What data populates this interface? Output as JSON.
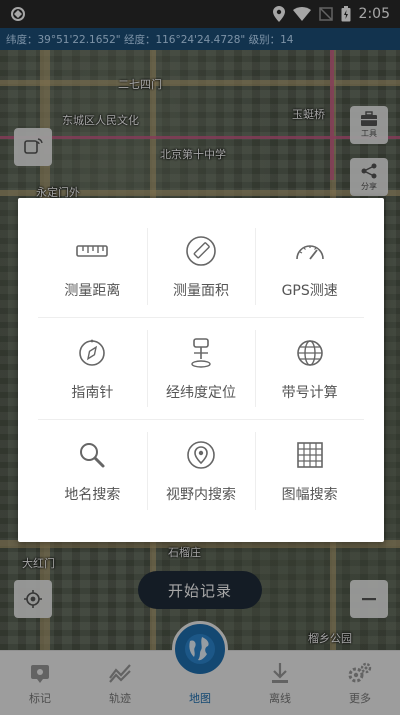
{
  "status_bar": {
    "time": "2:05"
  },
  "coord_bar": {
    "text": "纬度：39°51'22.1652\"  经度：116°24'24.4728\"  级别：14"
  },
  "map": {
    "labels": [
      "二七四门",
      "东城区人民文化",
      "北京第十中学",
      "永定门外",
      "玉蜓桥",
      "石榴庄",
      "大红门",
      "榴乡公园"
    ],
    "tools_button_label": "工具",
    "share_button_label": "分享"
  },
  "dialog": {
    "items": [
      {
        "label": "测量距离",
        "icon": "ruler-icon"
      },
      {
        "label": "测量面积",
        "icon": "area-ruler-icon"
      },
      {
        "label": "GPS测速",
        "icon": "speedometer-icon"
      },
      {
        "label": "指南针",
        "icon": "compass-icon"
      },
      {
        "label": "经纬度定位",
        "icon": "pin-icon"
      },
      {
        "label": "带号计算",
        "icon": "globe-grid-icon"
      },
      {
        "label": "地名搜索",
        "icon": "search-icon"
      },
      {
        "label": "视野内搜索",
        "icon": "location-icon"
      },
      {
        "label": "图幅搜索",
        "icon": "grid-icon"
      }
    ]
  },
  "record_button": {
    "label": "开始记录"
  },
  "bottom_nav": [
    {
      "label": "标记",
      "icon": "marker-icon"
    },
    {
      "label": "轨迹",
      "icon": "track-icon"
    },
    {
      "label": "地图",
      "icon": "globe-icon",
      "active": true
    },
    {
      "label": "离线",
      "icon": "download-icon"
    },
    {
      "label": "更多",
      "icon": "gears-icon"
    }
  ],
  "colors": {
    "accent": "#1e6fb0",
    "coord_bar": "#1d4f78",
    "record_button": "#1f2b3a"
  }
}
